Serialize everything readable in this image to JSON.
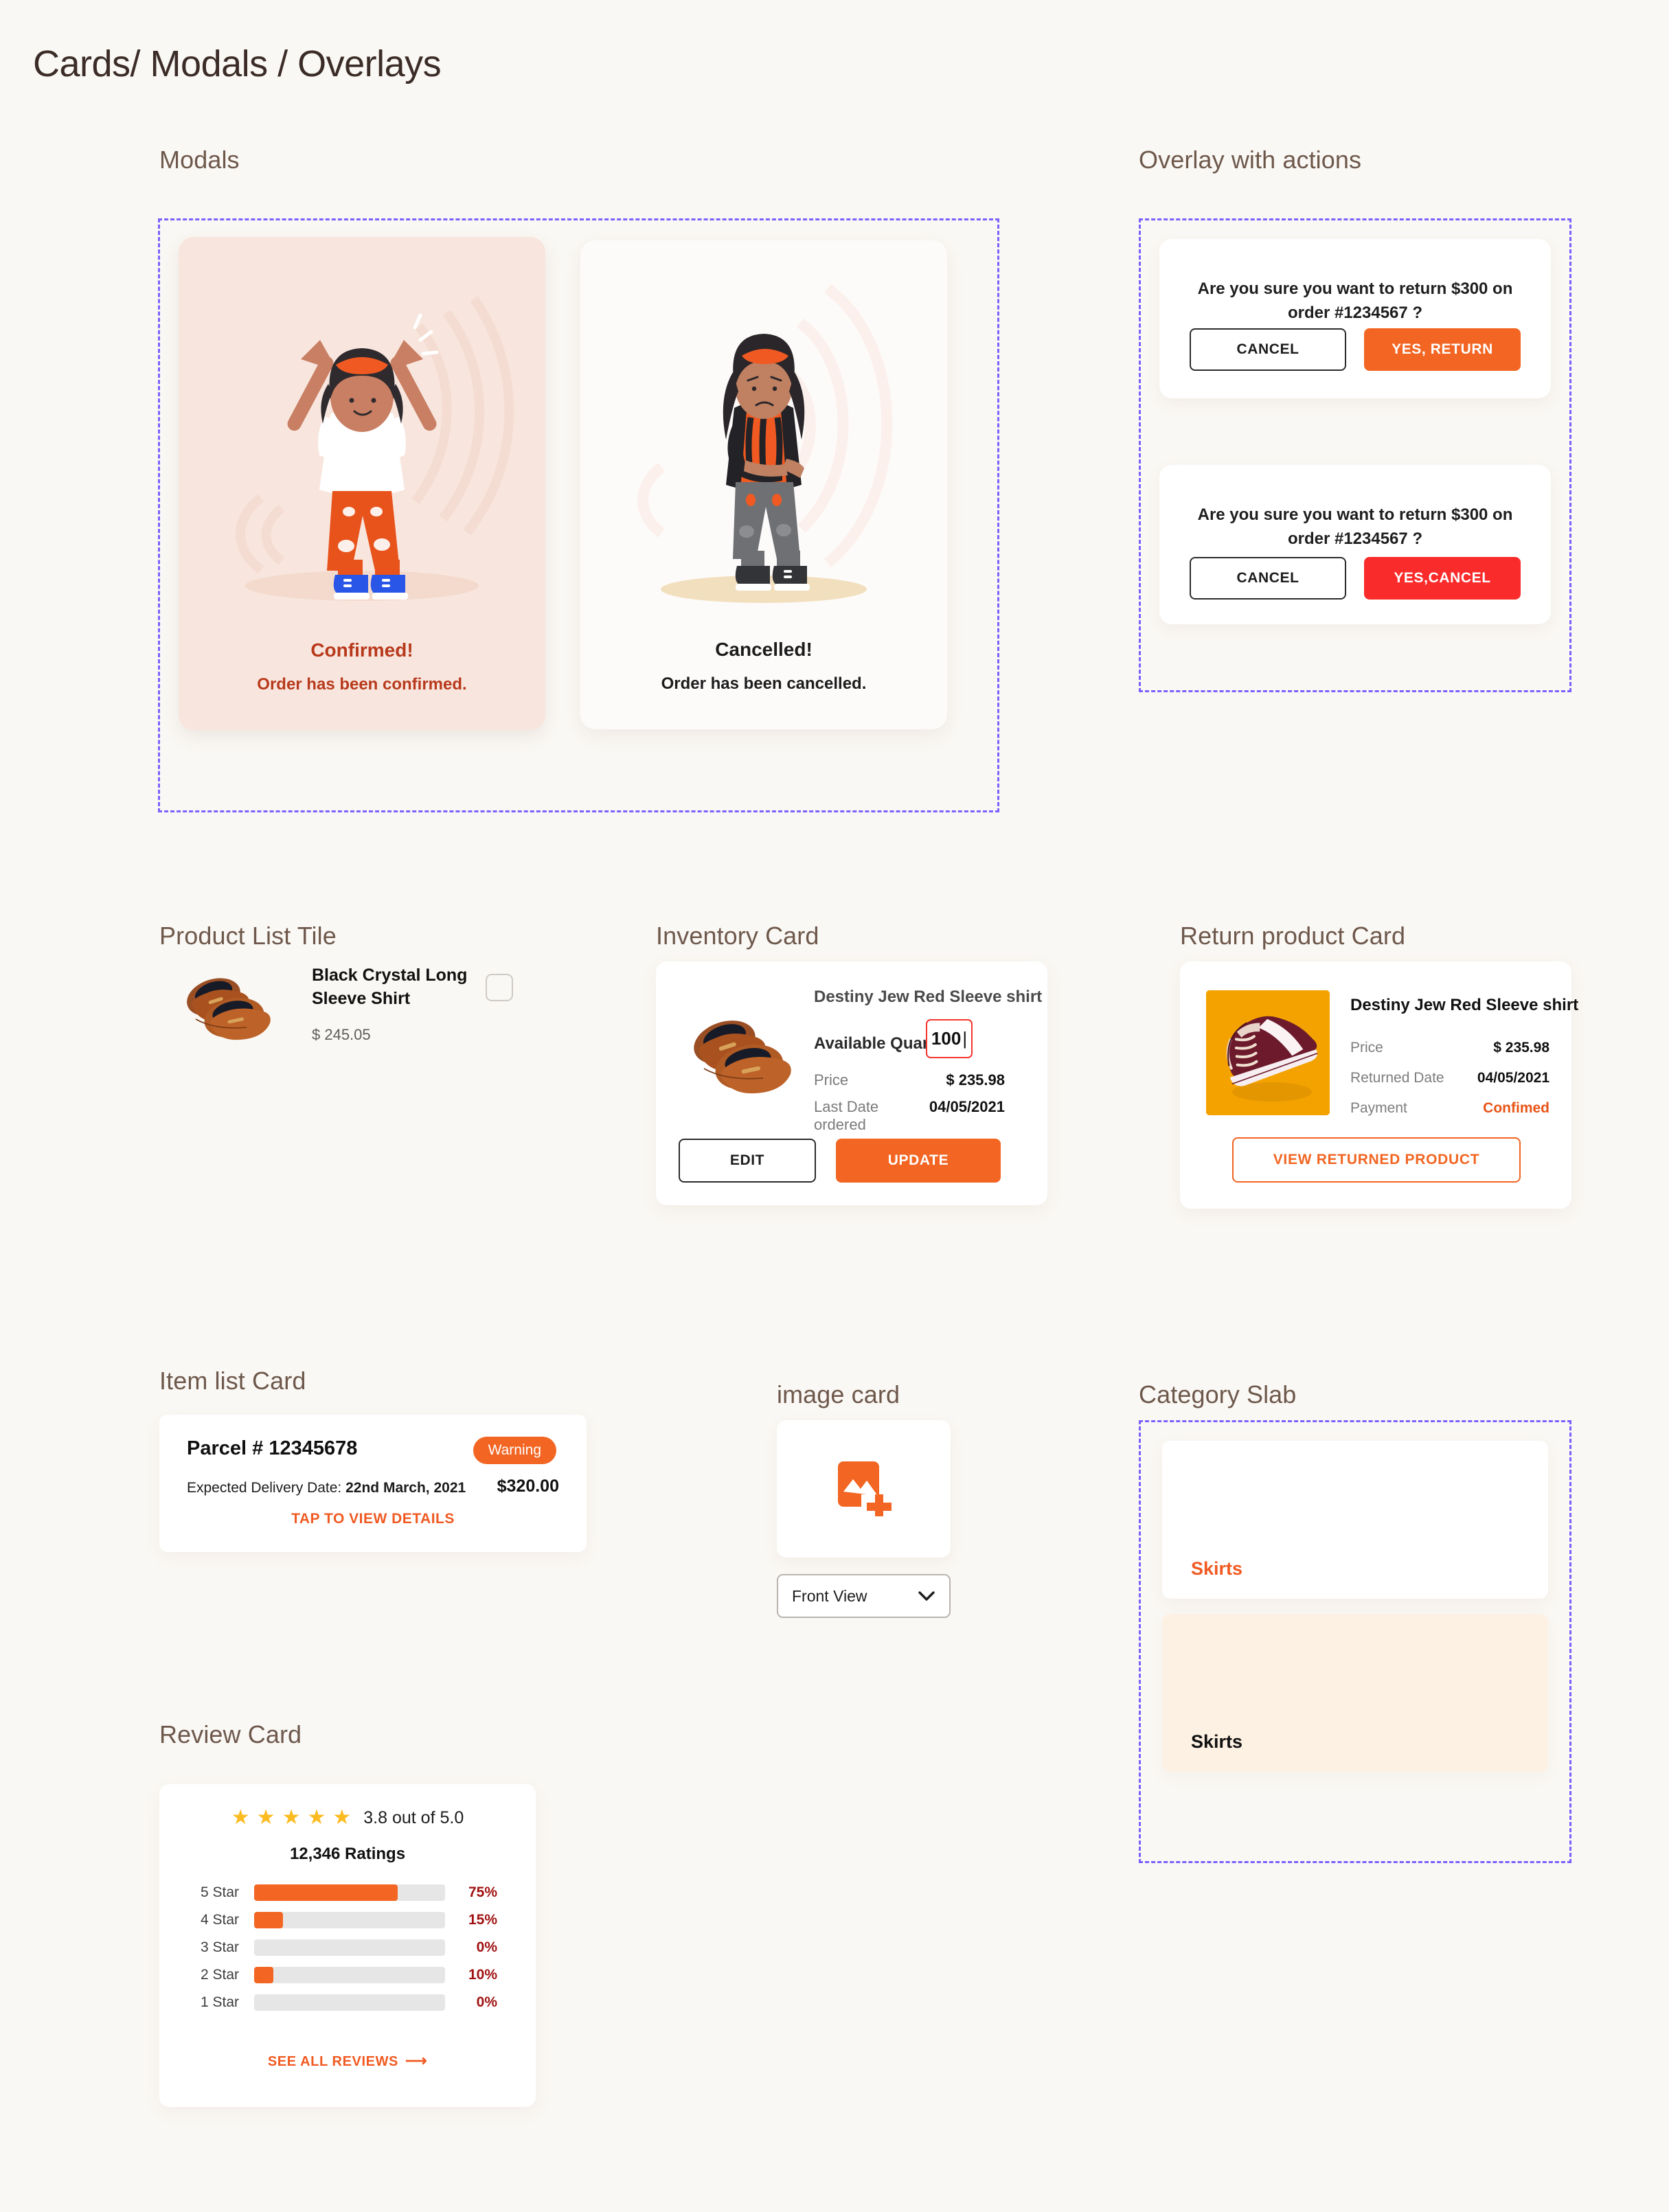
{
  "page": {
    "title": "Cards/ Modals / Overlays"
  },
  "modals": {
    "label": "Modals",
    "cards": [
      {
        "title": "Confirmed!",
        "subtitle": "Order has been confirmed.",
        "illustration": "happy-woman-illustration"
      },
      {
        "title": "Cancelled!",
        "subtitle": "Order has been cancelled.",
        "illustration": "upset-woman-illustration"
      }
    ]
  },
  "overlay": {
    "label": "Overlay with actions",
    "dialogs": [
      {
        "question": "Are you sure you want to return $300 on order #1234567 ?",
        "cancel_label": "CANCEL",
        "confirm_label": "YES, RETURN",
        "confirm_color": "#f26522"
      },
      {
        "question": "Are you sure you want to return $300 on order #1234567 ?",
        "cancel_label": "CANCEL",
        "confirm_label": "YES,CANCEL",
        "confirm_color": "#fa2b2b"
      }
    ]
  },
  "product_list_tile": {
    "label": "Product List Tile",
    "name": "Black Crystal Long Sleeve Shirt",
    "price": "$ 245.05",
    "image": "brown-loafers-image",
    "checkbox_checked": false
  },
  "inventory_card": {
    "label": "Inventory Card",
    "title": "Destiny Jew Red Sleeve shirt",
    "quantity_label": "Available Quantity",
    "quantity_value": "100",
    "quantity_border_color": "#f5352e",
    "rows": [
      {
        "key": "Price",
        "value": "$ 235.98"
      },
      {
        "key": "Last Date ordered",
        "value": "04/05/2021"
      }
    ],
    "edit_label": "EDIT",
    "update_label": "UPDATE",
    "image": "brown-loafers-image"
  },
  "return_product_card": {
    "label": "Return product Card",
    "title": "Destiny Jew Red Sleeve shirt",
    "rows": [
      {
        "key": "Price",
        "value": "$ 235.98",
        "accent": false
      },
      {
        "key": "Returned Date",
        "value": "04/05/2021",
        "accent": false
      },
      {
        "key": "Payment",
        "value": "Confimed",
        "accent": true
      }
    ],
    "button_label": "VIEW RETURNED PRODUCT",
    "image": "maroon-sneaker-image"
  },
  "item_list_card": {
    "label": "Item list Card",
    "parcel": "Parcel # 12345678",
    "badge": "Warning",
    "delivery_prefix": "Expected Delivery Date: ",
    "delivery_date": "22nd March, 2021",
    "amount": "$320.00",
    "tap_label": "TAP TO VIEW DETAILS"
  },
  "image_card": {
    "label": "image card",
    "icon": "add-image-icon",
    "select_value": "Front View",
    "chevron": "chevron-down-icon"
  },
  "category_slab": {
    "label": "Category Slab",
    "slabs": [
      {
        "text": "Skirts",
        "style": "white"
      },
      {
        "text": "Skirts",
        "style": "cream"
      }
    ]
  },
  "review_card": {
    "label": "Review Card",
    "score_text": "3.8 out of 5.0",
    "ratings_text": "12,346 Ratings",
    "see_all_label": "SEE ALL REVIEWS",
    "arrow": "arrow-right-icon"
  },
  "chart_data": {
    "type": "bar",
    "title": "12,346 Ratings",
    "orientation": "horizontal",
    "categories": [
      "5 Star",
      "4 Star",
      "3 Star",
      "2 Star",
      "1 Star"
    ],
    "values": [
      75,
      15,
      0,
      10,
      0
    ],
    "value_labels": [
      "75%",
      "15%",
      "0%",
      "10%",
      "0%"
    ],
    "xlabel": "",
    "ylabel": "",
    "xlim": [
      0,
      100
    ],
    "grid": false,
    "legend": false,
    "bar_color": "#f26522",
    "track_color": "#e6e6e6",
    "label_color": "#a11212",
    "rating_average": 3.8,
    "rating_max": 5.0,
    "stars_filled": 5
  }
}
